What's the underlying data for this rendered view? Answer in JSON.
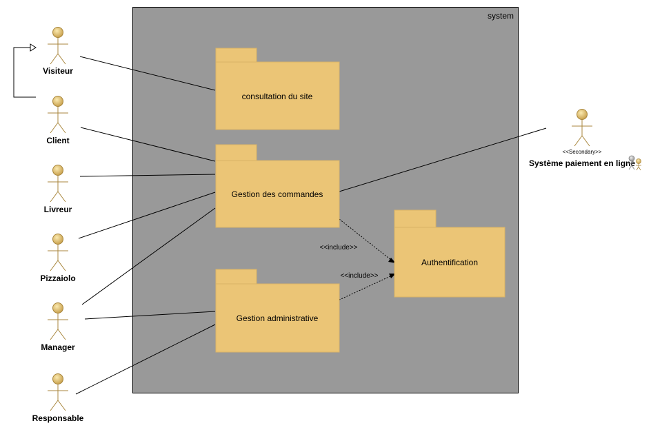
{
  "system": {
    "label": "system"
  },
  "packages": {
    "consultation": "consultation du site",
    "commandes": "Gestion des commandes",
    "administrative": "Gestion administrative",
    "authentification": "Authentification"
  },
  "actors": {
    "visiteur": "Visiteur",
    "client": "Client",
    "livreur": "Livreur",
    "pizzaiolo": "Pizzaiolo",
    "manager": "Manager",
    "responsable": "Responsable",
    "paiement": "Système paiement en ligne",
    "paiement_stereotype": "<<Secondary>>"
  },
  "relations": {
    "include1": "<<include>>",
    "include2": "<<include>>"
  },
  "colors": {
    "system_fill": "#999999",
    "package_fill": "#EBC576",
    "actor_fill": "#E0BC6C",
    "line": "#000000"
  }
}
